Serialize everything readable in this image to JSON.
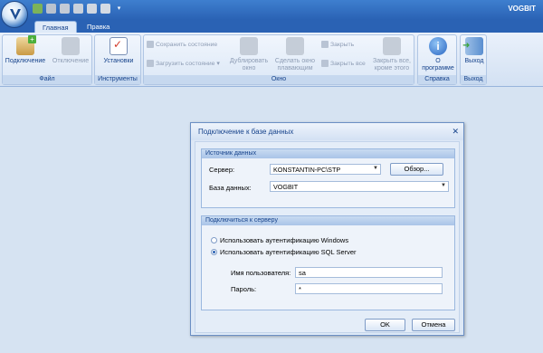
{
  "app": {
    "title": "VOGBIT"
  },
  "tabs": [
    {
      "label": "Главная"
    },
    {
      "label": "Правка"
    }
  ],
  "ribbon": {
    "file": {
      "label": "Файл",
      "connect": "Подключение",
      "disconnect": "Отключение"
    },
    "tools": {
      "label": "Инструменты",
      "settings": "Установки"
    },
    "window": {
      "label": "Окно",
      "save_state": "Сохранить состояние",
      "load_state": "Загрузить состояние",
      "duplicate": "Дублировать окно",
      "float": "Сделать окно плавающим",
      "close": "Закрыть",
      "close_all": "Закрыть все",
      "close_all_but_this": "Закрыть все, кроме этого"
    },
    "help": {
      "label": "Справка",
      "about": "О программе"
    },
    "exit": {
      "label": "Выход",
      "exit": "Выход"
    }
  },
  "dialog": {
    "title": "Подключение к базе данных",
    "close_glyph": "✕",
    "datasource": {
      "header": "Источник данных",
      "server_label": "Сервер:",
      "server_value": "KONSTANTIN-PC\\STP",
      "browse_label": "Обзор...",
      "db_label": "База данных:",
      "db_value": "VOGBIT"
    },
    "connect": {
      "header": "Подключиться к серверу",
      "auth_windows": "Использовать аутентификацию Windows",
      "auth_sql": "Использовать аутентификацию SQL Server",
      "user_label": "Имя пользователя:",
      "user_value": "sa",
      "password_label": "Пароль:",
      "password_value": "*"
    },
    "ok_label": "OK",
    "cancel_label": "Отмена"
  }
}
